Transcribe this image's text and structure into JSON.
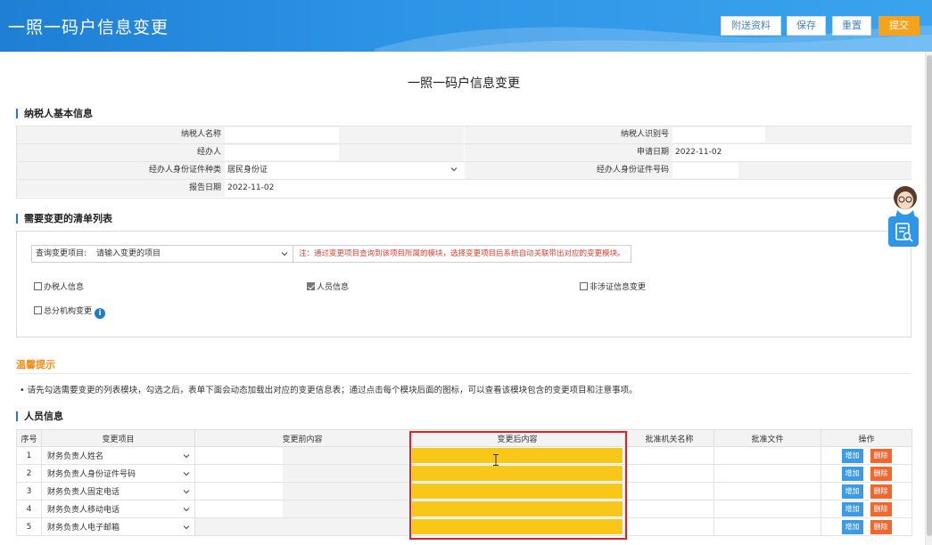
{
  "header": {
    "title": "一照一码户信息变更",
    "buttons": {
      "attach": "附送资料",
      "save": "保存",
      "reset": "重置",
      "submit": "提交"
    }
  },
  "page_title": "一照一码户信息变更",
  "basic_info": {
    "section_title": "纳税人基本信息",
    "taxpayer_name_label": "纳税人名称",
    "taxpayer_id_label": "纳税人识别号",
    "agent_label": "经办人",
    "apply_date_label": "申请日期",
    "apply_date": "2022-11-02",
    "agent_id_type_label": "经办人身份证件种类",
    "agent_id_type": "居民身份证",
    "agent_id_no_label": "经办人身份证件号码",
    "report_date_label": "报告日期",
    "report_date": "2022-11-02"
  },
  "change_list": {
    "section_title": "需要变更的清单列表",
    "query_label": "查询变更项目:",
    "query_placeholder": "请输入变更的项目",
    "note": "注：通过变更项目查询到该项目所属的模块，选择变更项目后系统自动关联带出对应的变更模块。",
    "checkboxes": [
      {
        "label": "办税人信息",
        "checked": false
      },
      {
        "label": "人员信息",
        "checked": true
      },
      {
        "label": "非涉证信息变更",
        "checked": false
      },
      {
        "label": "总分机构变更",
        "checked": false
      }
    ]
  },
  "tips": {
    "title": "温馨提示",
    "text": "请先勾选需要变更的列表模块，勾选之后，表单下面会动态加载出对应的变更信息表；通过点击每个模块后面的图标，可以查看该模块包含的变更项目和注意事项。"
  },
  "personnel": {
    "section_title": "人员信息",
    "columns": [
      "序号",
      "变更项目",
      "变更前内容",
      "变更后内容",
      "批准机关名称",
      "批准文件",
      "操作"
    ],
    "rows": [
      {
        "seq": "1",
        "item": "财务负责人姓名"
      },
      {
        "seq": "2",
        "item": "财务负责人身份证件号码"
      },
      {
        "seq": "3",
        "item": "财务负责人固定电话"
      },
      {
        "seq": "4",
        "item": "财务负责人移动电话"
      },
      {
        "seq": "5",
        "item": "财务负责人电子邮箱"
      }
    ],
    "add_label": "增加",
    "delete_label": "删除"
  },
  "colors": {
    "header_blue": "#2e95e6",
    "highlight_yellow": "#f8c718",
    "submit_orange": "#f6a21b",
    "annotation_red": "#e51e25"
  }
}
